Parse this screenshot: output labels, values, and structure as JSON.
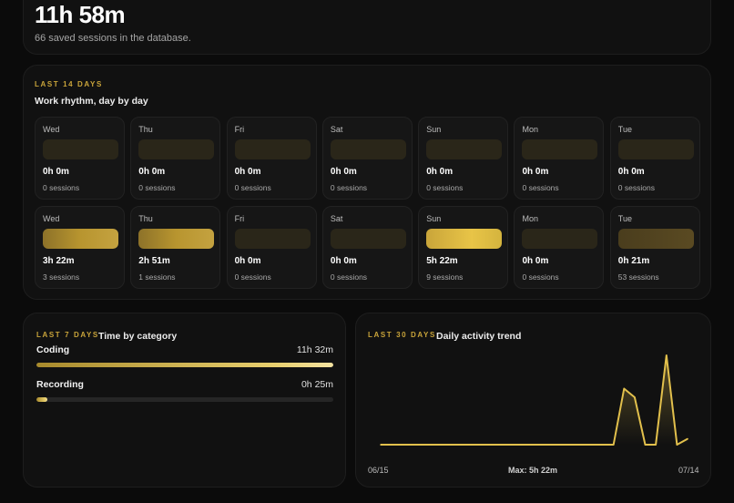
{
  "summary": {
    "total_time": "11h 58m",
    "saved_note": "66 saved sessions in the database."
  },
  "rhythm": {
    "kicker": "LAST 14 DAYS",
    "title": "Work rhythm, day by day",
    "days": [
      {
        "day": "Wed",
        "time": "0h 0m",
        "sessions": "0 sessions",
        "intensity": 0
      },
      {
        "day": "Thu",
        "time": "0h 0m",
        "sessions": "0 sessions",
        "intensity": 0
      },
      {
        "day": "Fri",
        "time": "0h 0m",
        "sessions": "0 sessions",
        "intensity": 0
      },
      {
        "day": "Sat",
        "time": "0h 0m",
        "sessions": "0 sessions",
        "intensity": 0
      },
      {
        "day": "Sun",
        "time": "0h 0m",
        "sessions": "0 sessions",
        "intensity": 0
      },
      {
        "day": "Mon",
        "time": "0h 0m",
        "sessions": "0 sessions",
        "intensity": 0
      },
      {
        "day": "Tue",
        "time": "0h 0m",
        "sessions": "0 sessions",
        "intensity": 0
      },
      {
        "day": "Wed",
        "time": "3h 22m",
        "sessions": "3 sessions",
        "intensity": 0.63
      },
      {
        "day": "Thu",
        "time": "2h 51m",
        "sessions": "1 sessions",
        "intensity": 0.53
      },
      {
        "day": "Fri",
        "time": "0h 0m",
        "sessions": "0 sessions",
        "intensity": 0
      },
      {
        "day": "Sat",
        "time": "0h 0m",
        "sessions": "0 sessions",
        "intensity": 0
      },
      {
        "day": "Sun",
        "time": "5h 22m",
        "sessions": "9 sessions",
        "intensity": 1
      },
      {
        "day": "Mon",
        "time": "0h 0m",
        "sessions": "0 sessions",
        "intensity": 0
      },
      {
        "day": "Tue",
        "time": "0h 21m",
        "sessions": "53 sessions",
        "intensity": 0.07
      }
    ]
  },
  "categories": {
    "kicker": "LAST 7 DAYS",
    "title": "Time by category",
    "items": [
      {
        "name": "Coding",
        "time": "11h 32m",
        "fraction": 1.0
      },
      {
        "name": "Recording",
        "time": "0h 25m",
        "fraction": 0.036
      }
    ]
  },
  "trend": {
    "kicker": "LAST 30 DAYS",
    "title": "Daily activity trend",
    "start_label": "06/15",
    "max_label": "Max: 5h 22m",
    "end_label": "07/14"
  },
  "chart_data": {
    "type": "line",
    "x": [
      "06/15",
      "06/16",
      "06/17",
      "06/18",
      "06/19",
      "06/20",
      "06/21",
      "06/22",
      "06/23",
      "06/24",
      "06/25",
      "06/26",
      "06/27",
      "06/28",
      "06/29",
      "06/30",
      "07/01",
      "07/02",
      "07/03",
      "07/04",
      "07/05",
      "07/06",
      "07/07",
      "07/08",
      "07/09",
      "07/10",
      "07/11",
      "07/12",
      "07/13",
      "07/14"
    ],
    "series": [
      {
        "values": [
          0,
          0,
          0,
          0,
          0,
          0,
          0,
          0,
          0,
          0,
          0,
          0,
          0,
          0,
          0,
          0,
          0,
          0,
          0,
          0,
          0,
          0,
          0,
          202,
          171,
          0,
          0,
          322,
          0,
          21
        ]
      }
    ],
    "unit": "minutes",
    "ymax": 322,
    "colors": {
      "line": "#e2c04c"
    }
  },
  "colors": {
    "accent": "#c9a43a",
    "bar_empty": "#2a2619",
    "bar_low": "#7a6224",
    "bar_high": "#e8c447"
  }
}
